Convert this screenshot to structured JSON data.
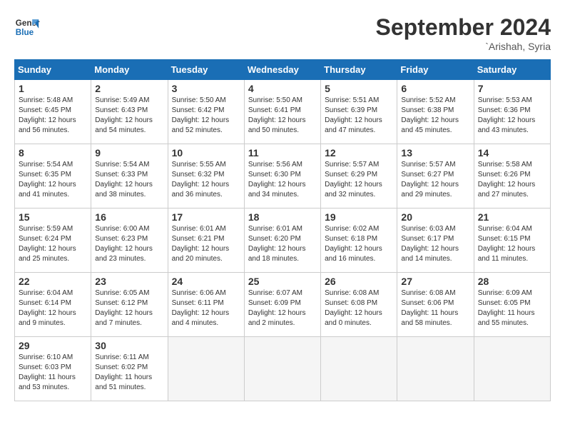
{
  "logo": {
    "line1": "General",
    "line2": "Blue"
  },
  "title": "September 2024",
  "location": "`Arishah, Syria",
  "days_of_week": [
    "Sunday",
    "Monday",
    "Tuesday",
    "Wednesday",
    "Thursday",
    "Friday",
    "Saturday"
  ],
  "weeks": [
    [
      {
        "day": 1,
        "info": "Sunrise: 5:48 AM\nSunset: 6:45 PM\nDaylight: 12 hours\nand 56 minutes."
      },
      {
        "day": 2,
        "info": "Sunrise: 5:49 AM\nSunset: 6:43 PM\nDaylight: 12 hours\nand 54 minutes."
      },
      {
        "day": 3,
        "info": "Sunrise: 5:50 AM\nSunset: 6:42 PM\nDaylight: 12 hours\nand 52 minutes."
      },
      {
        "day": 4,
        "info": "Sunrise: 5:50 AM\nSunset: 6:41 PM\nDaylight: 12 hours\nand 50 minutes."
      },
      {
        "day": 5,
        "info": "Sunrise: 5:51 AM\nSunset: 6:39 PM\nDaylight: 12 hours\nand 47 minutes."
      },
      {
        "day": 6,
        "info": "Sunrise: 5:52 AM\nSunset: 6:38 PM\nDaylight: 12 hours\nand 45 minutes."
      },
      {
        "day": 7,
        "info": "Sunrise: 5:53 AM\nSunset: 6:36 PM\nDaylight: 12 hours\nand 43 minutes."
      }
    ],
    [
      {
        "day": 8,
        "info": "Sunrise: 5:54 AM\nSunset: 6:35 PM\nDaylight: 12 hours\nand 41 minutes."
      },
      {
        "day": 9,
        "info": "Sunrise: 5:54 AM\nSunset: 6:33 PM\nDaylight: 12 hours\nand 38 minutes."
      },
      {
        "day": 10,
        "info": "Sunrise: 5:55 AM\nSunset: 6:32 PM\nDaylight: 12 hours\nand 36 minutes."
      },
      {
        "day": 11,
        "info": "Sunrise: 5:56 AM\nSunset: 6:30 PM\nDaylight: 12 hours\nand 34 minutes."
      },
      {
        "day": 12,
        "info": "Sunrise: 5:57 AM\nSunset: 6:29 PM\nDaylight: 12 hours\nand 32 minutes."
      },
      {
        "day": 13,
        "info": "Sunrise: 5:57 AM\nSunset: 6:27 PM\nDaylight: 12 hours\nand 29 minutes."
      },
      {
        "day": 14,
        "info": "Sunrise: 5:58 AM\nSunset: 6:26 PM\nDaylight: 12 hours\nand 27 minutes."
      }
    ],
    [
      {
        "day": 15,
        "info": "Sunrise: 5:59 AM\nSunset: 6:24 PM\nDaylight: 12 hours\nand 25 minutes."
      },
      {
        "day": 16,
        "info": "Sunrise: 6:00 AM\nSunset: 6:23 PM\nDaylight: 12 hours\nand 23 minutes."
      },
      {
        "day": 17,
        "info": "Sunrise: 6:01 AM\nSunset: 6:21 PM\nDaylight: 12 hours\nand 20 minutes."
      },
      {
        "day": 18,
        "info": "Sunrise: 6:01 AM\nSunset: 6:20 PM\nDaylight: 12 hours\nand 18 minutes."
      },
      {
        "day": 19,
        "info": "Sunrise: 6:02 AM\nSunset: 6:18 PM\nDaylight: 12 hours\nand 16 minutes."
      },
      {
        "day": 20,
        "info": "Sunrise: 6:03 AM\nSunset: 6:17 PM\nDaylight: 12 hours\nand 14 minutes."
      },
      {
        "day": 21,
        "info": "Sunrise: 6:04 AM\nSunset: 6:15 PM\nDaylight: 12 hours\nand 11 minutes."
      }
    ],
    [
      {
        "day": 22,
        "info": "Sunrise: 6:04 AM\nSunset: 6:14 PM\nDaylight: 12 hours\nand 9 minutes."
      },
      {
        "day": 23,
        "info": "Sunrise: 6:05 AM\nSunset: 6:12 PM\nDaylight: 12 hours\nand 7 minutes."
      },
      {
        "day": 24,
        "info": "Sunrise: 6:06 AM\nSunset: 6:11 PM\nDaylight: 12 hours\nand 4 minutes."
      },
      {
        "day": 25,
        "info": "Sunrise: 6:07 AM\nSunset: 6:09 PM\nDaylight: 12 hours\nand 2 minutes."
      },
      {
        "day": 26,
        "info": "Sunrise: 6:08 AM\nSunset: 6:08 PM\nDaylight: 12 hours\nand 0 minutes."
      },
      {
        "day": 27,
        "info": "Sunrise: 6:08 AM\nSunset: 6:06 PM\nDaylight: 11 hours\nand 58 minutes."
      },
      {
        "day": 28,
        "info": "Sunrise: 6:09 AM\nSunset: 6:05 PM\nDaylight: 11 hours\nand 55 minutes."
      }
    ],
    [
      {
        "day": 29,
        "info": "Sunrise: 6:10 AM\nSunset: 6:03 PM\nDaylight: 11 hours\nand 53 minutes."
      },
      {
        "day": 30,
        "info": "Sunrise: 6:11 AM\nSunset: 6:02 PM\nDaylight: 11 hours\nand 51 minutes."
      },
      null,
      null,
      null,
      null,
      null
    ]
  ]
}
